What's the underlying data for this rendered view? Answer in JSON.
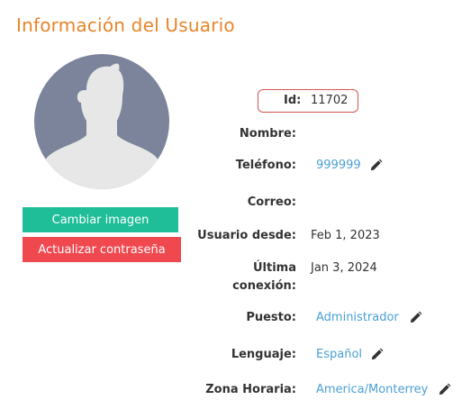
{
  "title": "Información del Usuario",
  "buttons": {
    "change_image": "Cambiar imagen",
    "update_password": "Actualizar contraseña"
  },
  "fields": {
    "id": {
      "label": "Id:",
      "value": "11702"
    },
    "nombre": {
      "label": "Nombre:",
      "value": ""
    },
    "telefono": {
      "label": "Teléfono:",
      "value": "999999"
    },
    "correo": {
      "label": "Correo:",
      "value": ""
    },
    "usuario_desde": {
      "label": "Usuario desde:",
      "value": "Feb 1, 2023"
    },
    "ultima_conexion": {
      "label_line1": "Última",
      "label_line2": "conexión:",
      "value": "Jan 3, 2024"
    },
    "puesto": {
      "label": "Puesto:",
      "value": "Administrador"
    },
    "lenguaje": {
      "label": "Lenguaje:",
      "value": "Español"
    },
    "zona_horaria": {
      "label": "Zona Horaria:",
      "value": "America/Monterrey"
    }
  },
  "icons": {
    "edit": "pencil-icon",
    "avatar": "user-silhouette"
  },
  "colors": {
    "title": "#e8852a",
    "primary_button": "#1fbd98",
    "danger_button": "#f0484f",
    "link": "#4a9fd5",
    "id_highlight": "#d9534f"
  }
}
